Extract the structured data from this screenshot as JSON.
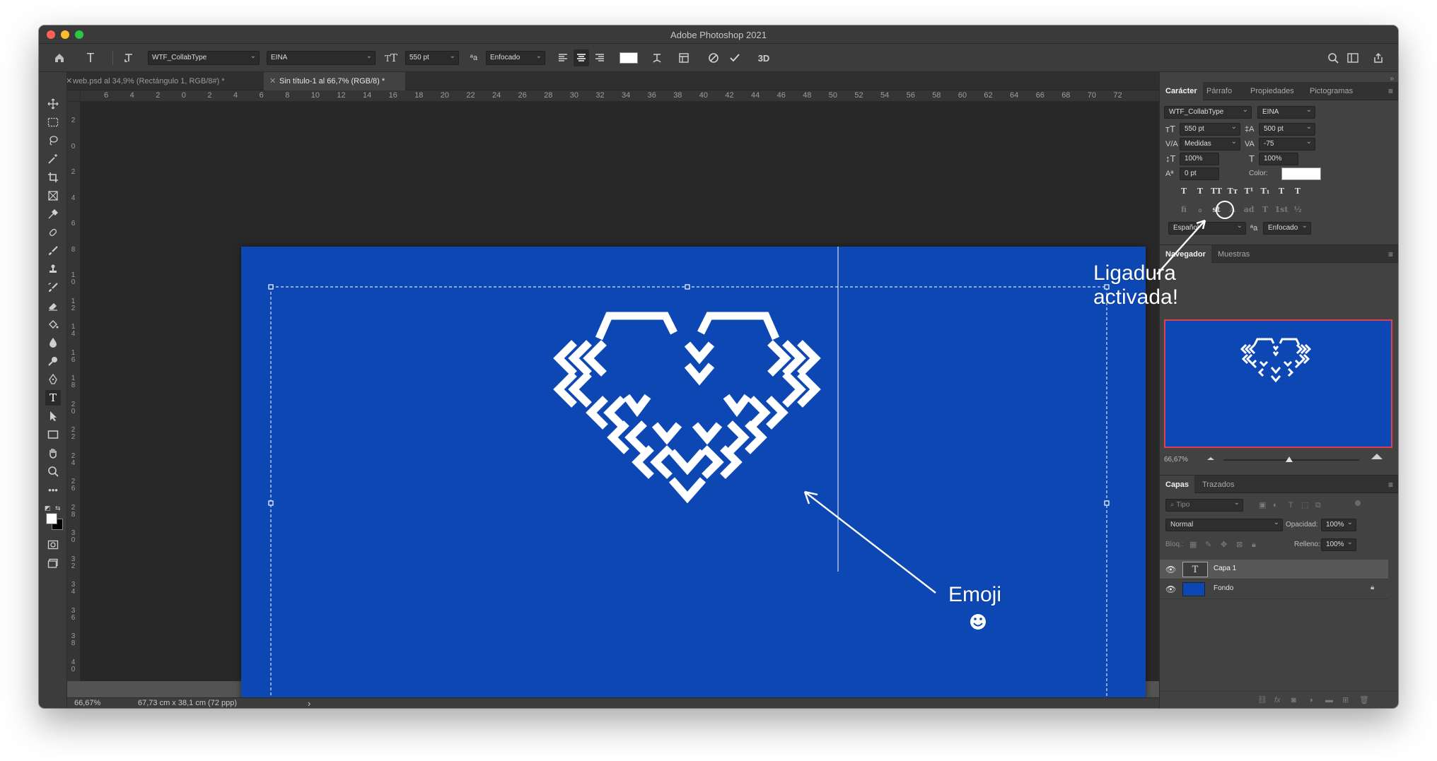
{
  "window": {
    "title": "Adobe Photoshop 2021"
  },
  "options_bar": {
    "font_family": "WTF_CollabType",
    "font_style": "EINA",
    "font_size": "550 pt",
    "antialias": "Enfocado",
    "icons": [
      "home-icon",
      "type-tool-icon",
      "text-orientation-icon",
      "font-size-icon",
      "antialias-icon",
      "align-left-icon",
      "align-center-icon",
      "align-right-icon",
      "warp-text-icon",
      "panels-icon",
      "cancel-icon",
      "commit-icon",
      "3d-icon",
      "search-icon",
      "workspace-icon",
      "share-icon"
    ],
    "text_color": "#ffffff",
    "label_3d": "3D"
  },
  "tabs": [
    {
      "label": "web.psd al 34,9% (Rectángulo 1, RGB/8#) *",
      "active": false
    },
    {
      "label": "Sin título-1 al 66,7% (RGB/8) *",
      "active": true
    }
  ],
  "ruler_h": [
    "6",
    "4",
    "2",
    "0",
    "2",
    "4",
    "6",
    "8",
    "10",
    "12",
    "14",
    "16",
    "18",
    "20",
    "22",
    "24",
    "26",
    "28",
    "30",
    "32",
    "34",
    "36",
    "38",
    "40",
    "42",
    "44",
    "46",
    "48",
    "50",
    "52",
    "54",
    "56",
    "58",
    "60",
    "62",
    "64",
    "66",
    "68",
    "70",
    "72"
  ],
  "ruler_v": [
    "2",
    "0",
    "2",
    "4",
    "6",
    "8",
    "10",
    "12",
    "14",
    "16",
    "18",
    "20",
    "22",
    "24",
    "26",
    "28",
    "30",
    "32",
    "34",
    "36",
    "38",
    "40"
  ],
  "status": {
    "zoom": "66,67%",
    "doc_size": "67,73 cm x 38,1 cm (72 ppp)",
    "arrow": "›"
  },
  "canvas": {
    "background": "#0c47b3"
  },
  "character_panel": {
    "tabs": [
      "Carácter",
      "Párrafo",
      "Propiedades",
      "Pictogramas"
    ],
    "font_family": "WTF_CollabType",
    "font_style": "EINA",
    "font_size": "550 pt",
    "leading": "500 pt",
    "kerning": "Medidas",
    "tracking": "-75",
    "vertical_scale": "100%",
    "horizontal_scale": "100%",
    "baseline_shift": "0 pt",
    "color_label": "Color:",
    "language": "Español",
    "antialias": "Enfocado",
    "aa_icon": "ªa",
    "style_buttons": [
      "T",
      "T",
      "TT",
      "Tт",
      "T¹",
      "T₁",
      "T",
      "T"
    ],
    "opentype_buttons": [
      "ﬁ",
      "ℴ",
      "st",
      "A",
      "ad",
      "T",
      "1st",
      "½"
    ]
  },
  "navigator_panel": {
    "tabs": [
      "Navegador",
      "Muestras"
    ],
    "zoom": "66,67%"
  },
  "layers_panel": {
    "tabs": [
      "Capas",
      "Trazados"
    ],
    "filter_placeholder": "Tipo",
    "blend_mode": "Normal",
    "opacity_label": "Opacidad:",
    "opacity": "100%",
    "lock_label": "Bloq.:",
    "fill_label": "Relleno:",
    "fill": "100%",
    "layers": [
      {
        "name": "Capa 1",
        "type": "text",
        "selected": true
      },
      {
        "name": "Fondo",
        "type": "fill",
        "locked": true
      }
    ]
  },
  "annotations": {
    "ligature_line1": "Ligadura",
    "ligature_line2": "activada!",
    "emoji": "Emoji"
  }
}
